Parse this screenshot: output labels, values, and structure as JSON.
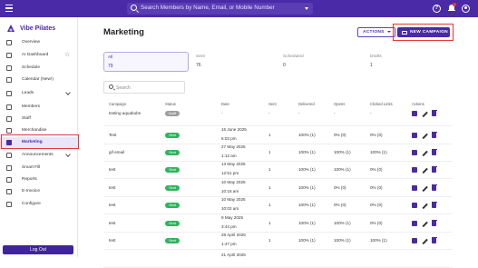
{
  "topbar": {
    "search_placeholder": "Search Members by Name, Email, or Mobile Number"
  },
  "sidebar": {
    "brand": "Vibe Pilates",
    "items": [
      {
        "label": "Overview",
        "icon": "grid-icon"
      },
      {
        "label": "AI Dashboard",
        "icon": "ai-icon"
      },
      {
        "label": "Schedule",
        "icon": "calendar-icon"
      },
      {
        "label": "Calendar (New!)",
        "icon": "calendar-icon"
      },
      {
        "label": "Leads",
        "icon": "filter-icon"
      },
      {
        "label": "Members",
        "icon": "members-icon"
      },
      {
        "label": "Staff",
        "icon": "staff-icon"
      },
      {
        "label": "Merchandise",
        "icon": "bag-icon"
      },
      {
        "label": "Marketing",
        "icon": "megaphone-icon"
      },
      {
        "label": "Announcements",
        "icon": "bell-icon"
      },
      {
        "label": "Smart Fill",
        "icon": "pin-icon"
      },
      {
        "label": "Reports",
        "icon": "report-icon"
      },
      {
        "label": "E-Invoice",
        "icon": "invoice-icon"
      },
      {
        "label": "Configure",
        "icon": "gear-icon"
      }
    ],
    "logout": "Log Out"
  },
  "main": {
    "title": "Marketing",
    "actions_label": "ACTIONS",
    "new_campaign_label": "NEW CAMPAIGN",
    "stats": [
      {
        "label": "All",
        "value": "79"
      },
      {
        "label": "Sent",
        "value": "76"
      },
      {
        "label": "Scheduled",
        "value": "0"
      },
      {
        "label": "Drafts",
        "value": "1"
      }
    ],
    "search_placeholder": "Search",
    "columns": [
      "Campaign",
      "Status",
      "Date",
      "Sent",
      "Delivered",
      "Opens",
      "Clicked Links",
      "Actions"
    ],
    "rows": [
      {
        "campaign": "testing aquabubs",
        "status": "Draft",
        "date": "-",
        "time": "",
        "sent": "-",
        "delivered": "-",
        "opens": "-",
        "clicks": "-"
      },
      {
        "campaign": "Test",
        "status": "Sent",
        "date": "16 June 2025",
        "time": "5:03 pm",
        "sent": "1",
        "delivered": "100% (1)",
        "opens": "0% (0)",
        "clicks": "0% (0)"
      },
      {
        "campaign": "gif email",
        "status": "Sent",
        "date": "27 May 2025",
        "time": "1:13 am",
        "sent": "1",
        "delivered": "100% (1)",
        "opens": "100% (1)",
        "clicks": "100% (1)"
      },
      {
        "campaign": "test",
        "status": "Sent",
        "date": "13 May 2025",
        "time": "12:51 pm",
        "sent": "1",
        "delivered": "100% (1)",
        "opens": "100% (1)",
        "clicks": "0% (0)"
      },
      {
        "campaign": "test",
        "status": "Sent",
        "date": "10 May 2025",
        "time": "10:16 am",
        "sent": "1",
        "delivered": "100% (1)",
        "opens": "0% (0)",
        "clicks": "0% (0)"
      },
      {
        "campaign": "test",
        "status": "Sent",
        "date": "10 May 2025",
        "time": "10:02 am",
        "sent": "1",
        "delivered": "100% (1)",
        "opens": "0% (0)",
        "clicks": "0% (0)"
      },
      {
        "campaign": "test",
        "status": "Sent",
        "date": "9 May 2025",
        "time": "3:44 pm",
        "sent": "1",
        "delivered": "100% (1)",
        "opens": "100% (1)",
        "clicks": "0% (0)"
      },
      {
        "campaign": "test",
        "status": "Sent",
        "date": "28 April 2025",
        "time": "1:47 pm",
        "sent": "1",
        "delivered": "100% (1)",
        "opens": "100% (1)",
        "clicks": "100% (1)"
      },
      {
        "campaign": "",
        "status": "",
        "date": "21 April 2025",
        "time": "",
        "sent": "",
        "delivered": "",
        "opens": "",
        "clicks": ""
      }
    ]
  },
  "colors": {
    "primary": "#4a2aa6",
    "sent": "#2db55d",
    "draft": "#9e9e9e",
    "highlight": "#e53935"
  }
}
